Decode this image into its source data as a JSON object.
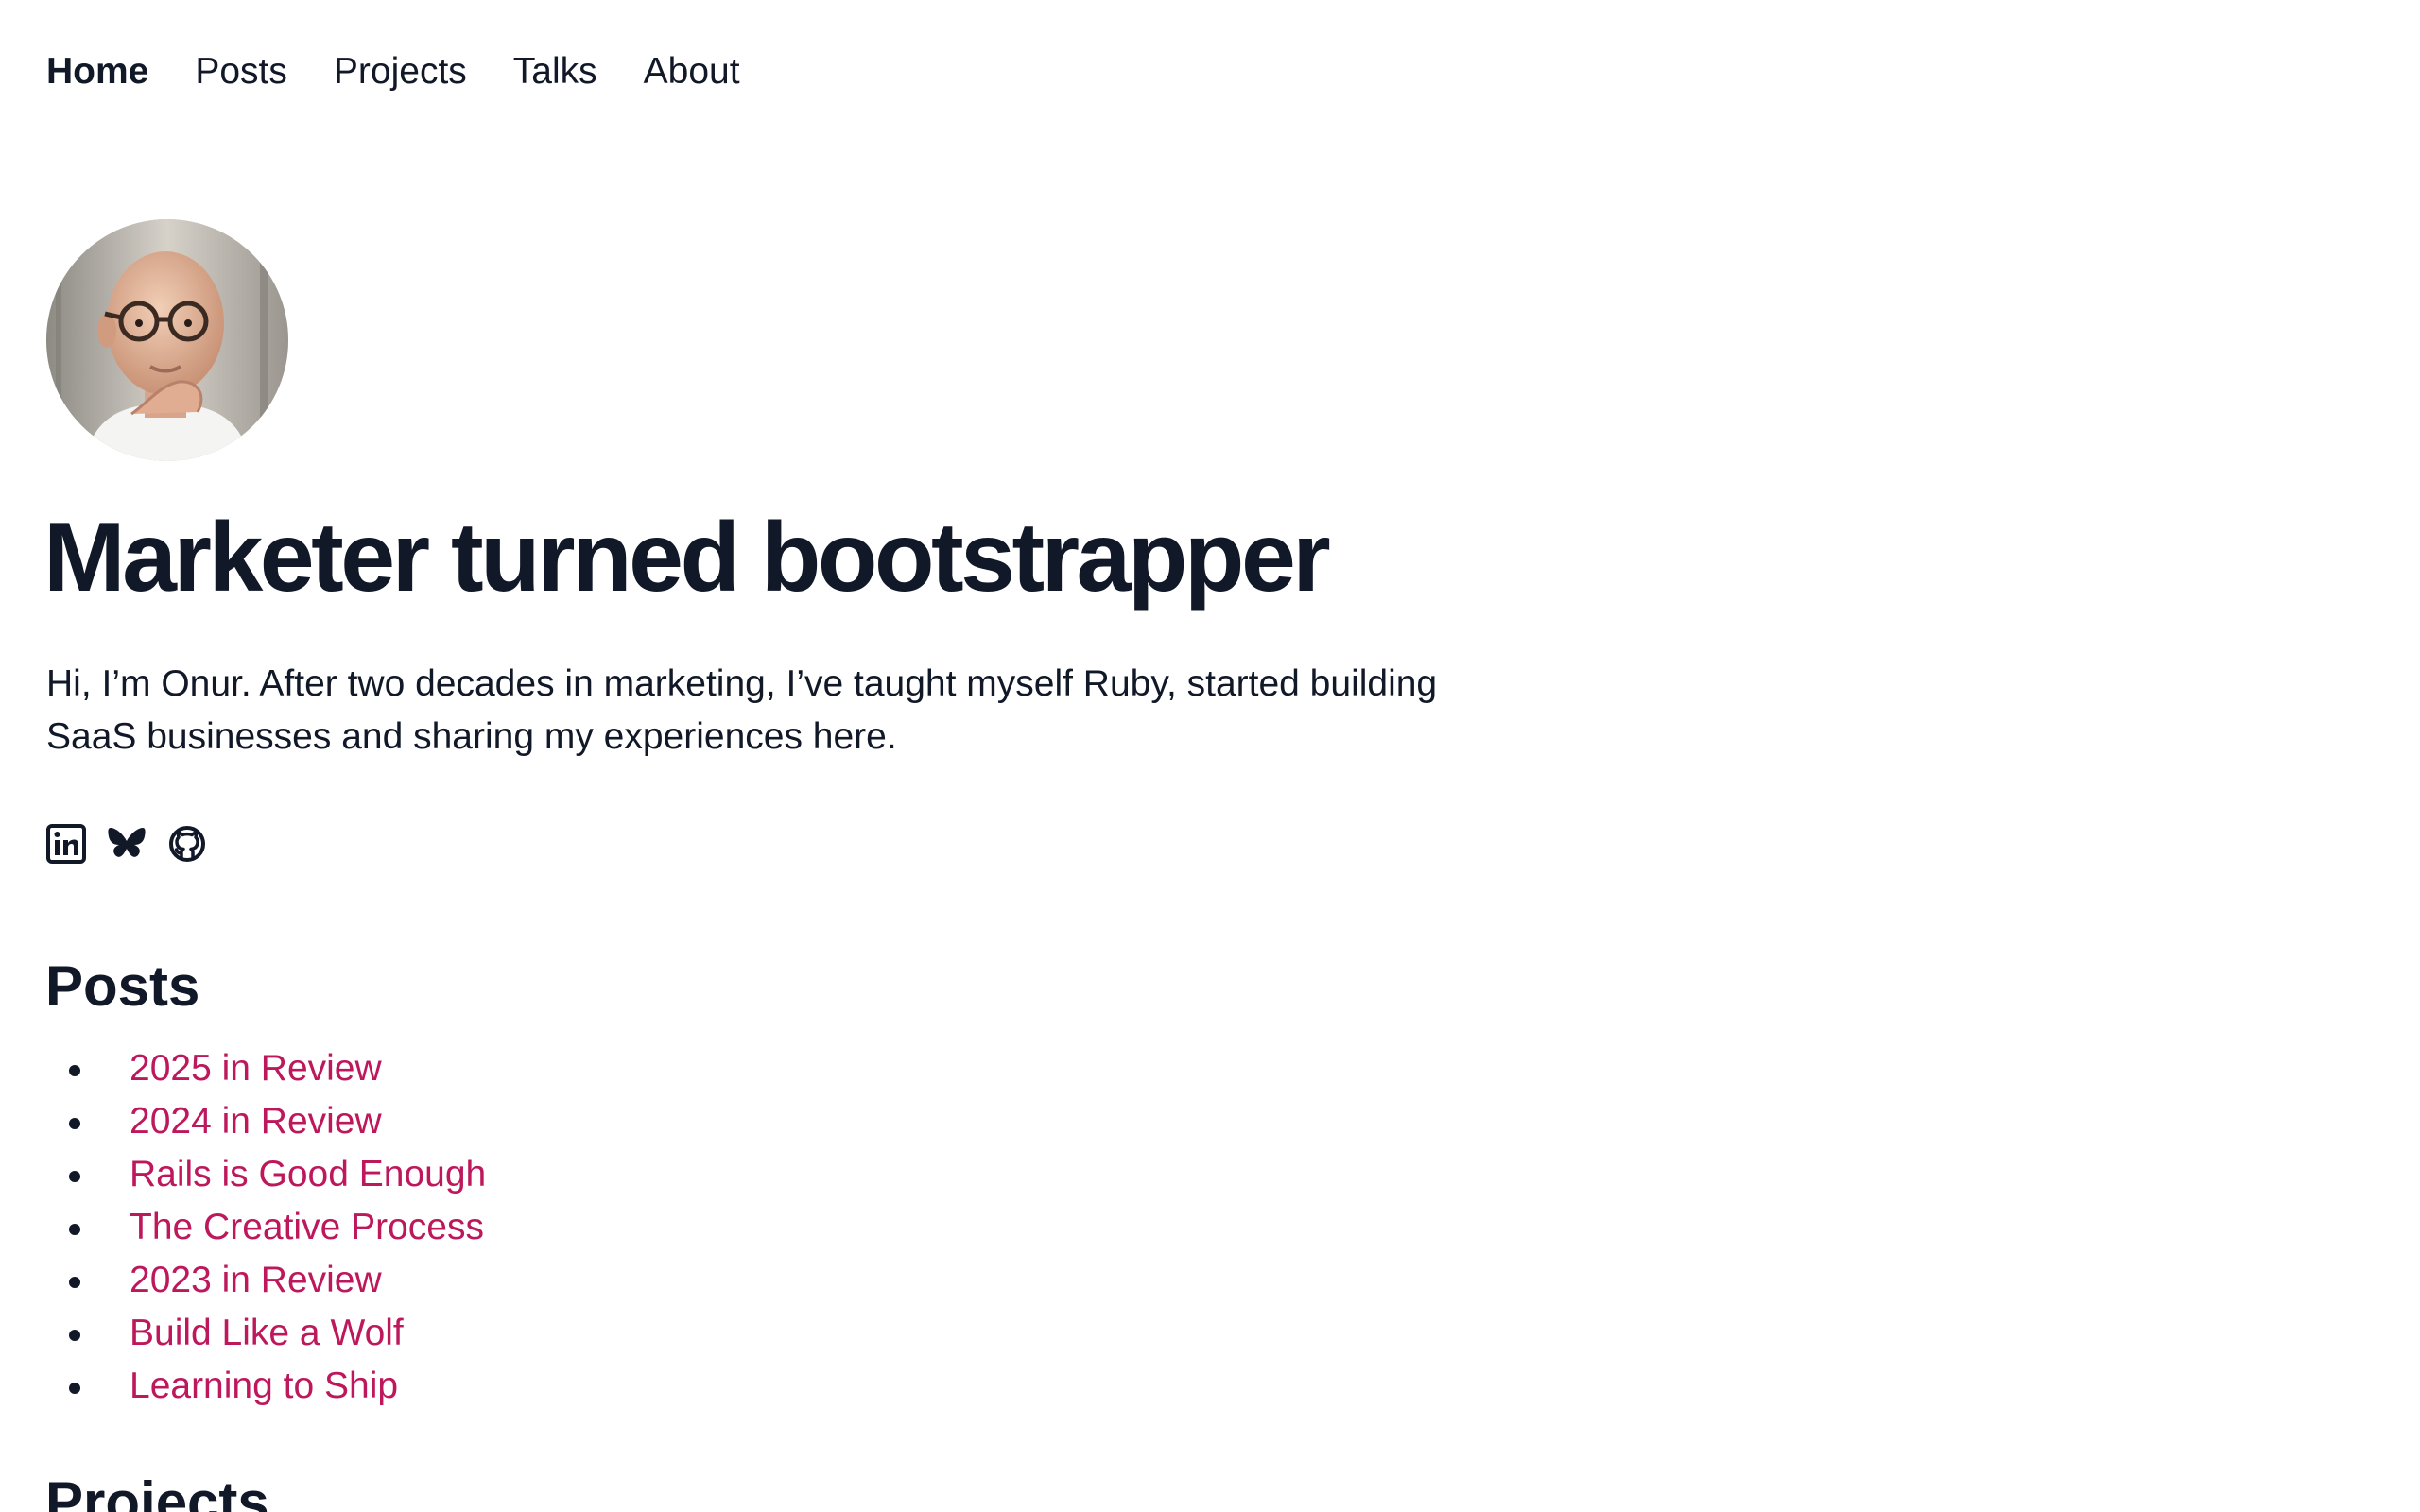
{
  "nav": {
    "items": [
      {
        "label": "Home",
        "active": true
      },
      {
        "label": "Posts",
        "active": false
      },
      {
        "label": "Projects",
        "active": false
      },
      {
        "label": "Talks",
        "active": false
      },
      {
        "label": "About",
        "active": false
      }
    ]
  },
  "hero": {
    "title": "Marketer turned bootstrapper",
    "intro": "Hi, I’m Onur. After two decades in marketing, I’ve taught myself Ruby, started building SaaS businesses and sharing my experiences here."
  },
  "socials": [
    {
      "icon": "linkedin-icon"
    },
    {
      "icon": "bluesky-icon"
    },
    {
      "icon": "github-icon"
    }
  ],
  "posts": {
    "title": "Posts",
    "items": [
      "2025 in Review",
      "2024 in Review",
      "Rails is Good Enough",
      "The Creative Process",
      "2023 in Review",
      "Build Like a Wolf",
      "Learning to Ship"
    ]
  },
  "projects": {
    "title": "Projects"
  },
  "colors": {
    "text": "#111827",
    "link": "#be185d"
  }
}
